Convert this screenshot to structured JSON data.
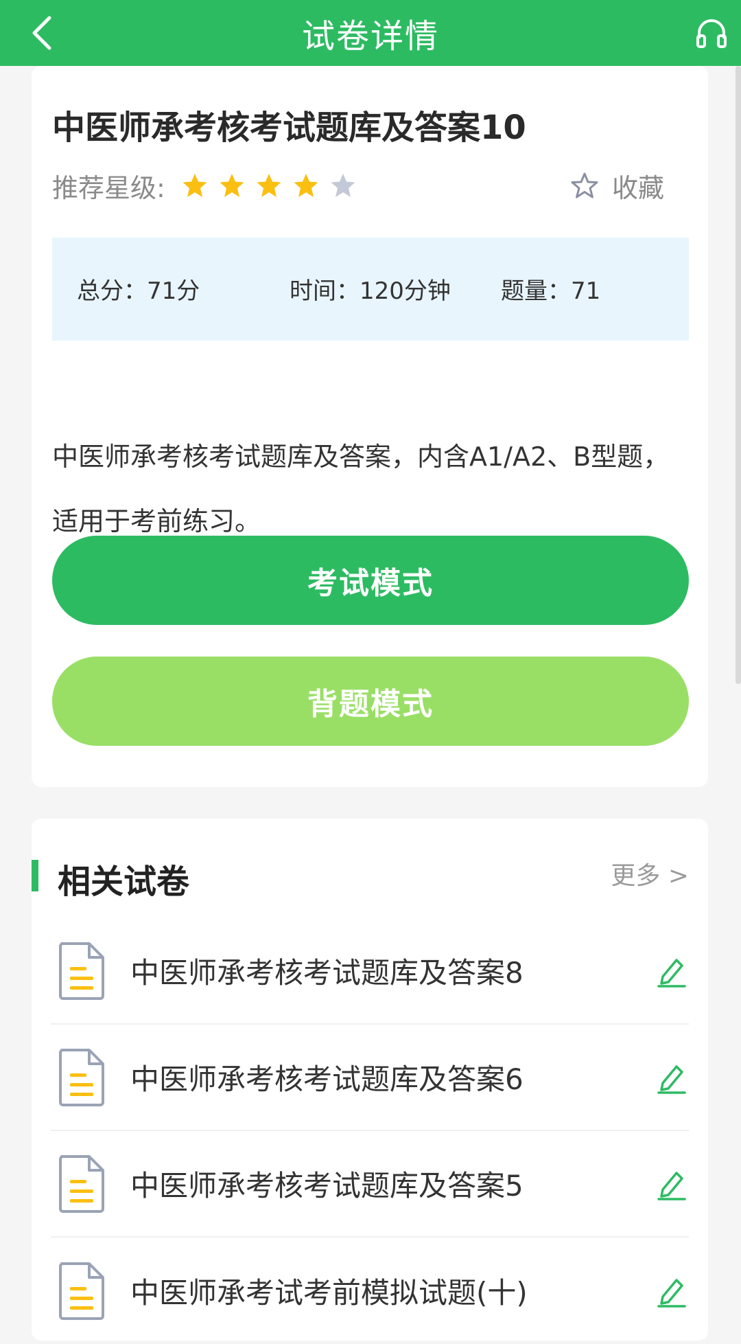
{
  "header": {
    "title": "试卷详情",
    "back_icon": "chevron-left-icon",
    "right_icon": "headphones-icon"
  },
  "paper": {
    "title": "中医师承考核考试题库及答案10",
    "rating_label": "推荐星级:",
    "rating": 4,
    "rating_max": 5,
    "favorite_label": "收藏",
    "stats": {
      "total_score": "总分：71分",
      "time": "时间：120分钟",
      "question_count": "题量：71"
    },
    "description_lines": [
      "中医师承考核考试题库及答案，内含A1/A2、B型题，",
      "适用于考前练习。"
    ],
    "exam_mode_label": "考试模式",
    "recite_mode_label": "背题模式"
  },
  "related": {
    "section_title": "相关试卷",
    "more_label": "更多 >",
    "items": [
      {
        "label": "中医师承考核考试题库及答案8"
      },
      {
        "label": "中医师承考核考试题库及答案6"
      },
      {
        "label": "中医师承考核考试题库及答案5"
      },
      {
        "label": "中医师承考试考前模拟试题(十)"
      }
    ]
  },
  "colors": {
    "brand_green": "#2dbb62",
    "light_green": "#99df66",
    "star_active": "#fbbf12",
    "star_inactive": "#c3c9d6",
    "stats_bg": "#e8f5fd"
  }
}
